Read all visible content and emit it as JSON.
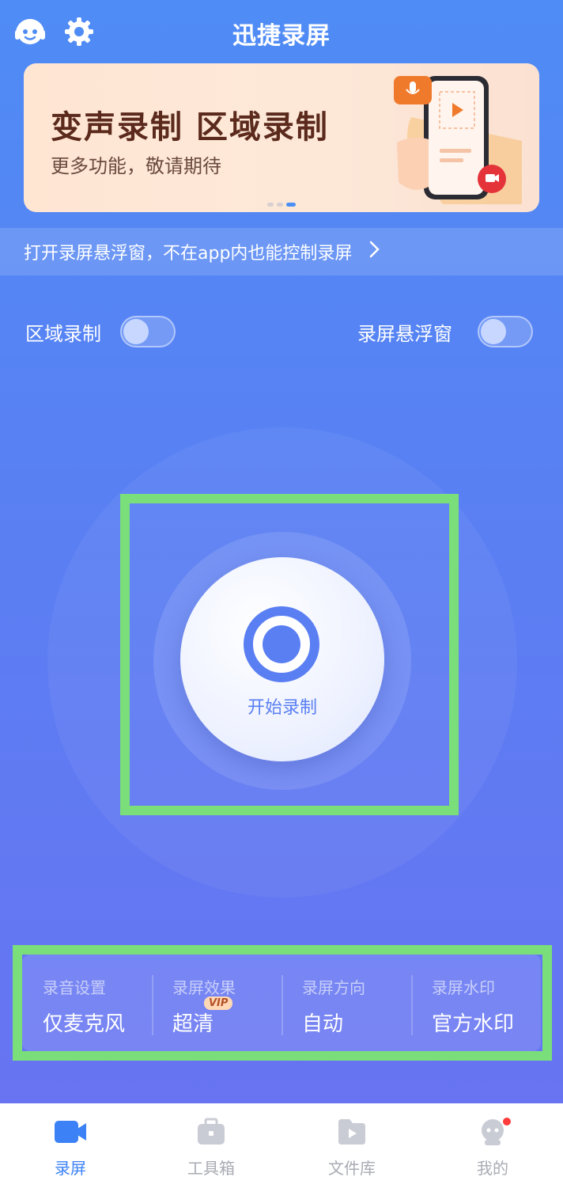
{
  "app": {
    "title": "迅捷录屏"
  },
  "banner": {
    "title": "变声录制 区域录制",
    "subtitle": "更多功能，敬请期待",
    "page_count": 3,
    "active_page": 3
  },
  "notice": {
    "text": "打开录屏悬浮窗，不在app内也能控制录屏"
  },
  "toggles": [
    {
      "label": "区域录制",
      "on": false
    },
    {
      "label": "录屏悬浮窗",
      "on": false
    }
  ],
  "record": {
    "label": "开始录制"
  },
  "settings": [
    {
      "label": "录音设置",
      "value": "仅麦克风"
    },
    {
      "label": "录屏效果",
      "value": "超清",
      "badge": "VIP"
    },
    {
      "label": "录屏方向",
      "value": "自动"
    },
    {
      "label": "录屏水印",
      "value": "官方水印"
    }
  ],
  "nav": [
    {
      "label": "录屏",
      "icon": "video-camera-icon",
      "active": true
    },
    {
      "label": "工具箱",
      "icon": "toolbox-icon",
      "active": false
    },
    {
      "label": "文件库",
      "icon": "folder-play-icon",
      "active": false
    },
    {
      "label": "我的",
      "icon": "avatar-icon",
      "active": false,
      "notification": true
    }
  ],
  "colors": {
    "accent": "#3c82f6",
    "record": "#5a7ff3",
    "highlight": "#7ade7a"
  }
}
